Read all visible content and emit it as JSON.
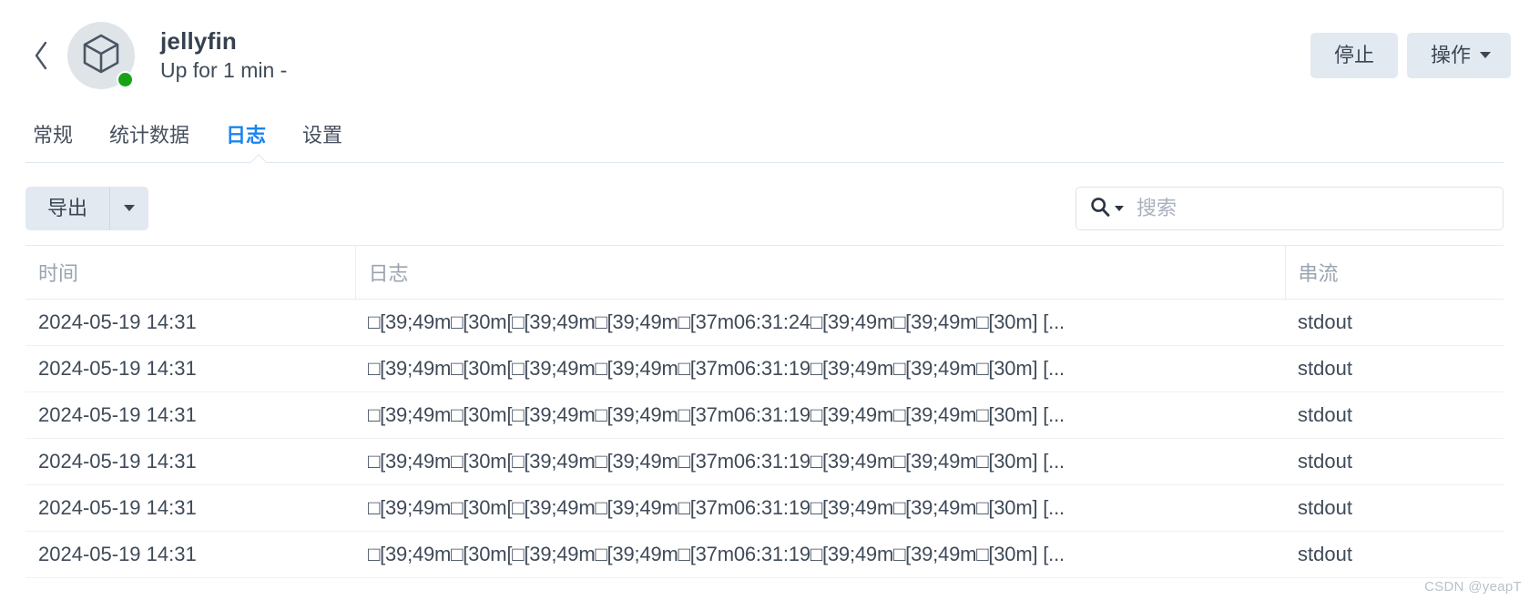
{
  "header": {
    "back_icon": "chevron-left-icon",
    "container_icon": "cube-icon",
    "status_color": "#17a217",
    "title": "jellyfin",
    "subtitle": "Up for 1 min -",
    "stop_label": "停止",
    "actions_label": "操作"
  },
  "tabs": [
    {
      "label": "常规",
      "active": false
    },
    {
      "label": "统计数据",
      "active": false
    },
    {
      "label": "日志",
      "active": true
    },
    {
      "label": "设置",
      "active": false
    }
  ],
  "toolbar": {
    "export_label": "导出",
    "export_dropdown_icon": "caret-down-icon",
    "search": {
      "icon": "search-icon",
      "dropdown_icon": "caret-down-icon",
      "placeholder": "搜索",
      "value": ""
    }
  },
  "table": {
    "columns": [
      "时间",
      "日志",
      "串流"
    ],
    "rows": [
      {
        "time": "2024-05-19 14:31",
        "log": "□[39;49m□[30m[□[39;49m□[39;49m□[37m06:31:24□[39;49m□[39;49m□[30m] [...",
        "stream": "stdout"
      },
      {
        "time": "2024-05-19 14:31",
        "log": "□[39;49m□[30m[□[39;49m□[39;49m□[37m06:31:19□[39;49m□[39;49m□[30m] [...",
        "stream": "stdout"
      },
      {
        "time": "2024-05-19 14:31",
        "log": "□[39;49m□[30m[□[39;49m□[39;49m□[37m06:31:19□[39;49m□[39;49m□[30m] [...",
        "stream": "stdout"
      },
      {
        "time": "2024-05-19 14:31",
        "log": "□[39;49m□[30m[□[39;49m□[39;49m□[37m06:31:19□[39;49m□[39;49m□[30m] [...",
        "stream": "stdout"
      },
      {
        "time": "2024-05-19 14:31",
        "log": "□[39;49m□[30m[□[39;49m□[39;49m□[37m06:31:19□[39;49m□[39;49m□[30m] [...",
        "stream": "stdout"
      },
      {
        "time": "2024-05-19 14:31",
        "log": "□[39;49m□[30m[□[39;49m□[39;49m□[37m06:31:19□[39;49m□[39;49m□[30m] [...",
        "stream": "stdout"
      }
    ]
  },
  "watermark": "CSDN @yeapT"
}
